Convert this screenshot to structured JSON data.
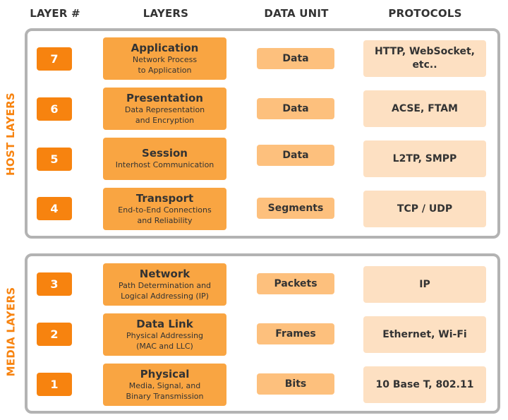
{
  "headers": {
    "layer_num": "LAYER #",
    "layers": "LAYERS",
    "data_unit": "DATA UNIT",
    "protocols": "PROTOCOLS"
  },
  "groups": {
    "host": {
      "label": "HOST LAYERS"
    },
    "media": {
      "label": "MEDIA LAYERS"
    }
  },
  "colors": {
    "accent": "#f7830f",
    "layer_box": "#f9a542",
    "unit_box": "#fdc07d",
    "protocol_box": "#fde0c2",
    "group_border": "#b3b3b3",
    "text": "#333333"
  },
  "rows": [
    {
      "number": "7",
      "name": "Application",
      "desc1": "Network Process",
      "desc2": "to Application",
      "unit": "Data",
      "protocols": "HTTP, WebSocket, etc.."
    },
    {
      "number": "6",
      "name": "Presentation",
      "desc1": "Data Representation",
      "desc2": "and Encryption",
      "unit": "Data",
      "protocols": "ACSE, FTAM"
    },
    {
      "number": "5",
      "name": "Session",
      "desc1": "Interhost Communication",
      "desc2": "",
      "unit": "Data",
      "protocols": "L2TP, SMPP"
    },
    {
      "number": "4",
      "name": "Transport",
      "desc1": "End-to-End Connections",
      "desc2": "and Reliability",
      "unit": "Segments",
      "protocols": "TCP / UDP"
    },
    {
      "number": "3",
      "name": "Network",
      "desc1": "Path Determination and",
      "desc2": "Logical Addressing (IP)",
      "unit": "Packets",
      "protocols": "IP"
    },
    {
      "number": "2",
      "name": "Data Link",
      "desc1": "Physical Addressing",
      "desc2": "(MAC and LLC)",
      "unit": "Frames",
      "protocols": "Ethernet, Wi-Fi"
    },
    {
      "number": "1",
      "name": "Physical",
      "desc1": "Media, Signal, and",
      "desc2": "Binary Transmission",
      "unit": "Bits",
      "protocols": "10 Base T, 802.11"
    }
  ]
}
